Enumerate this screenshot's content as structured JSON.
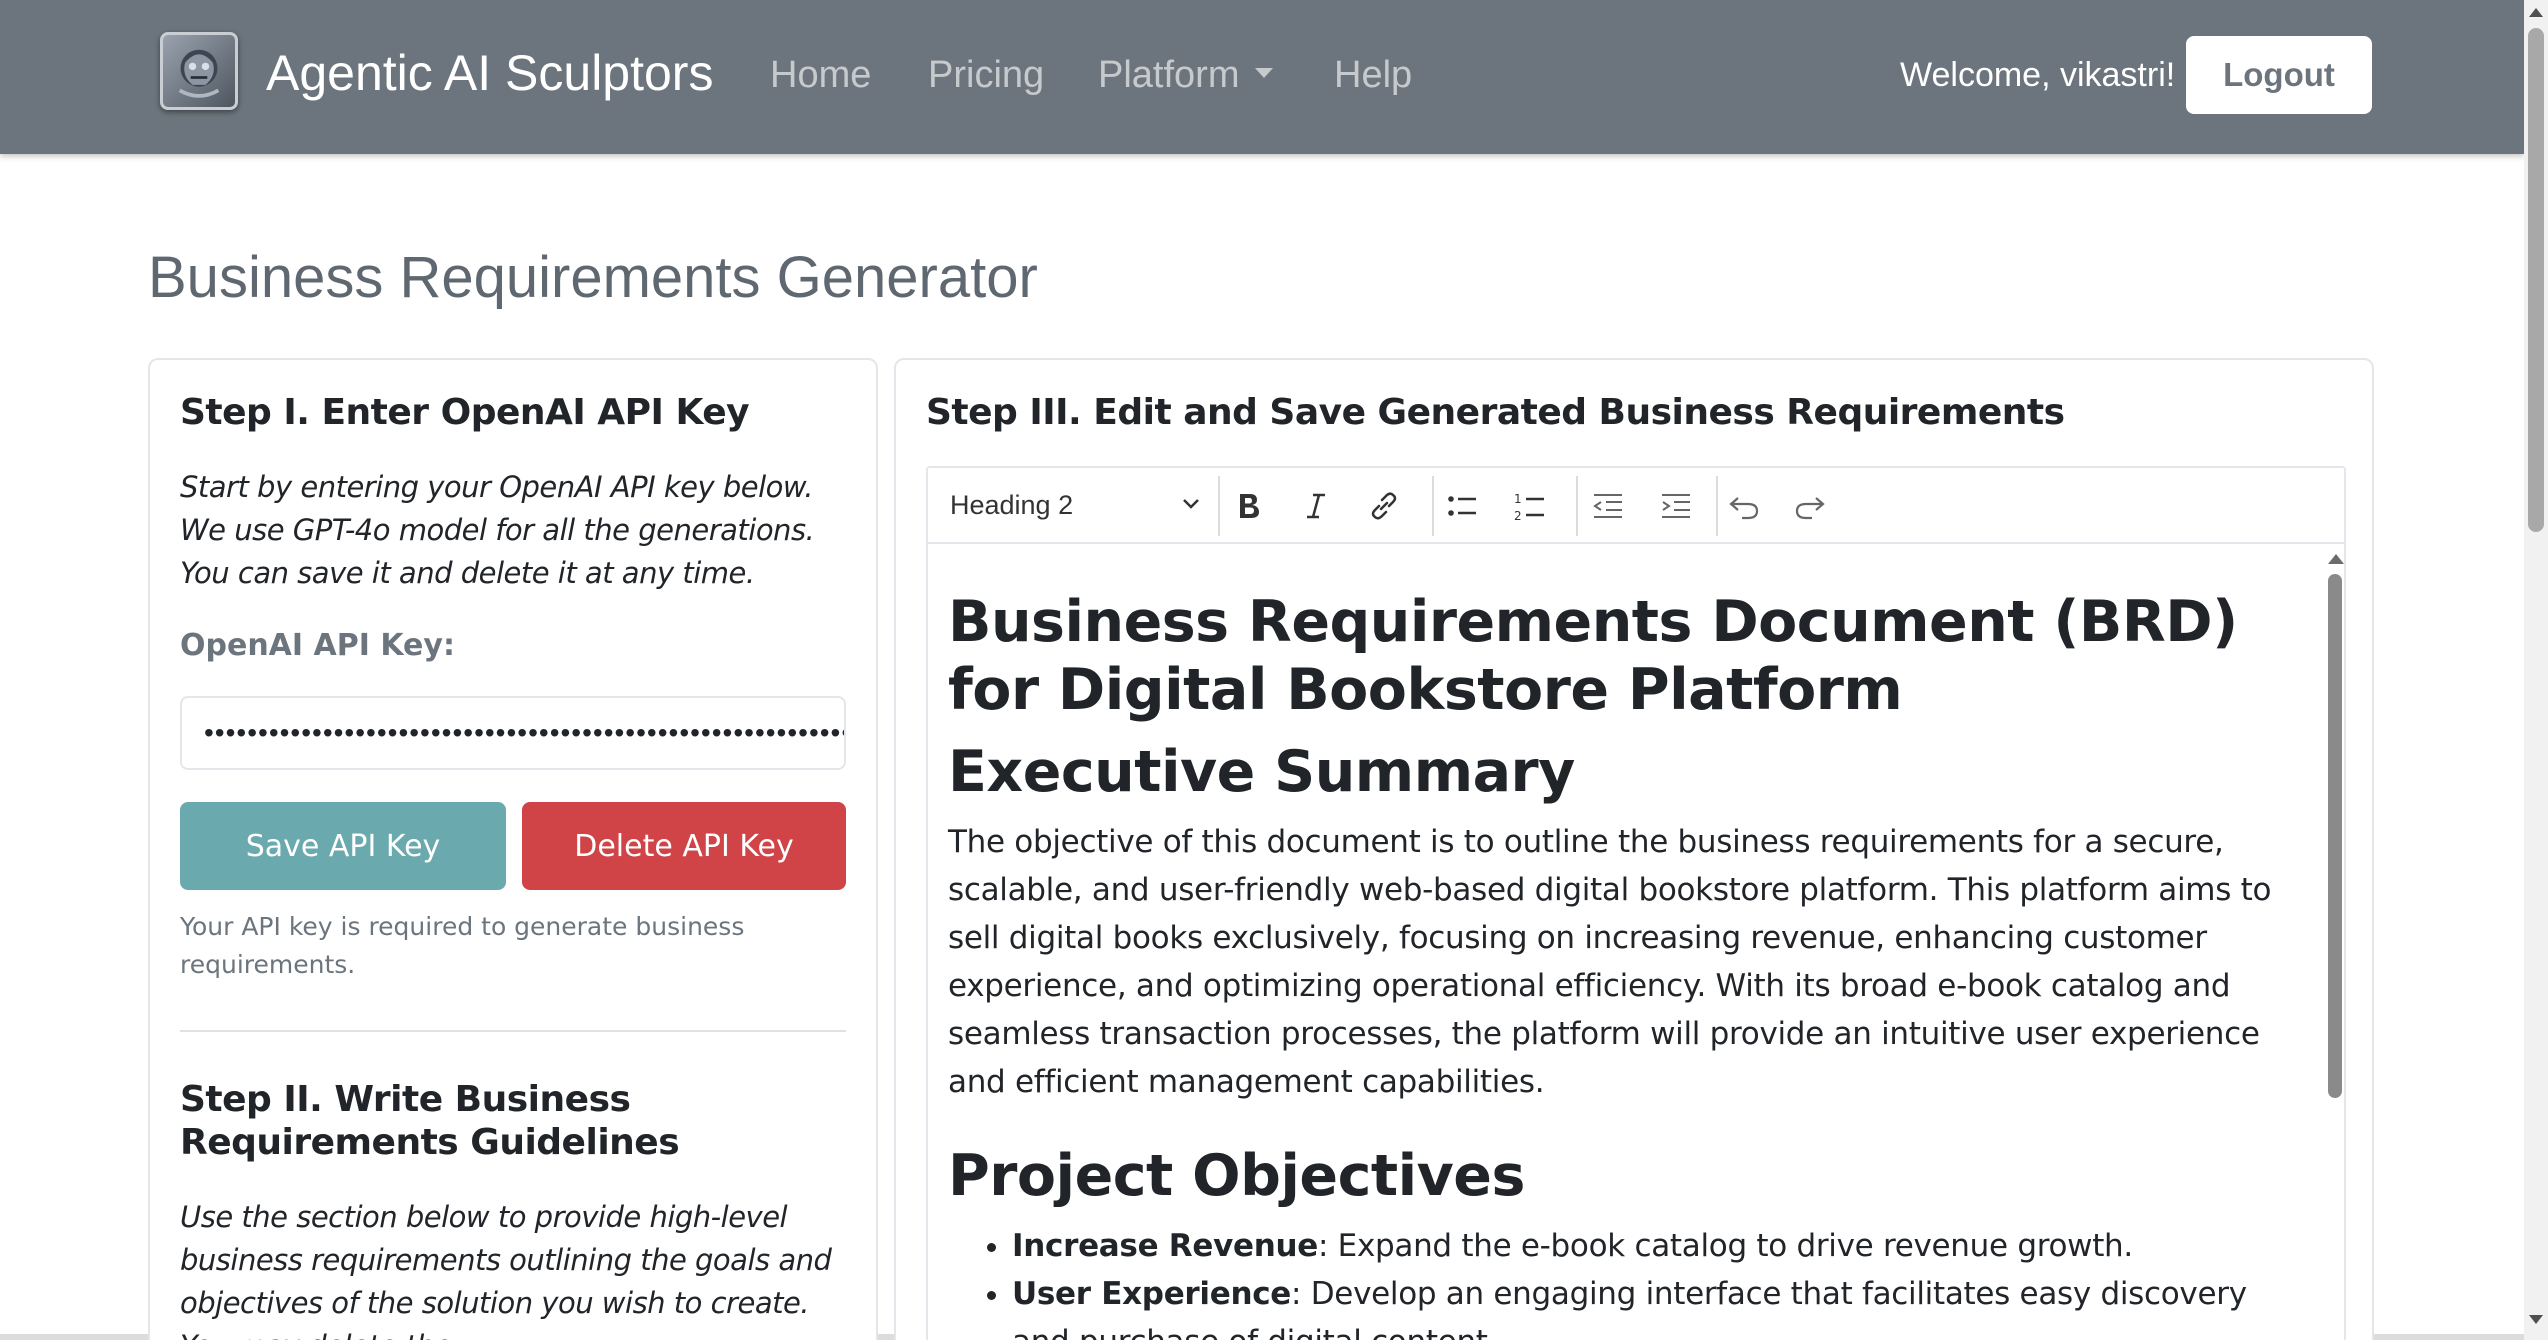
{
  "navbar": {
    "brand": "Agentic AI Sculptors",
    "links": [
      {
        "label": "Home"
      },
      {
        "label": "Pricing"
      },
      {
        "label": "Platform"
      },
      {
        "label": "Help"
      }
    ],
    "welcome": "Welcome, vikastri!",
    "logout": "Logout",
    "icons": [
      "brand-logo-icon",
      "chevron-down-icon"
    ]
  },
  "page": {
    "title": "Business Requirements Generator"
  },
  "step1": {
    "title": "Step I. Enter OpenAI API Key",
    "intro": "Start by entering your OpenAI API key below. We use GPT-4o model for all the generations. You can save it and delete it at any time.",
    "label": "OpenAI API Key:",
    "input_value": "••••••••••••••••••••••••••••••••••••••••••••••••••••••••••••",
    "save_label": "Save API Key",
    "delete_label": "Delete API Key",
    "help": "Your API key is required to generate business requirements."
  },
  "step2": {
    "title": "Step II. Write Business Requirements Guidelines",
    "intro": "Use the section below to provide high-level business requirements outlining the goals and objectives of the solution you wish to create. You may delete the"
  },
  "step3": {
    "title": "Step III. Edit and Save Generated Business Requirements",
    "toolbar": {
      "heading_value": "Heading 2",
      "tools": [
        "bold-icon",
        "italic-icon",
        "link-icon",
        "bulleted-list-icon",
        "numbered-list-icon",
        "outdent-icon",
        "indent-icon",
        "undo-icon",
        "redo-icon"
      ]
    },
    "document": {
      "h1": "Business Requirements Document (BRD) for Digital Bookstore Platform",
      "summary_heading": "Executive Summary",
      "summary_text": "The objective of this document is to outline the business requirements for a secure, scalable, and user-friendly web-based digital bookstore platform. This platform aims to sell digital books exclusively, focusing on increasing revenue, enhancing customer experience, and optimizing operational efficiency. With its broad e-book catalog and seamless transaction processes, the platform will provide an intuitive user experience and efficient management capabilities.",
      "objectives_heading": "Project Objectives",
      "objectives": [
        {
          "term": "Increase Revenue",
          "text": ": Expand the e-book catalog to drive revenue growth."
        },
        {
          "term": "User Experience",
          "text": ": Develop an engaging interface that facilitates easy discovery and purchase of digital content."
        }
      ]
    }
  },
  "colors": {
    "navbar": "#6c757d",
    "save_button": "#6aa9ae",
    "delete_button": "#d04347",
    "title": "#5f6870"
  }
}
